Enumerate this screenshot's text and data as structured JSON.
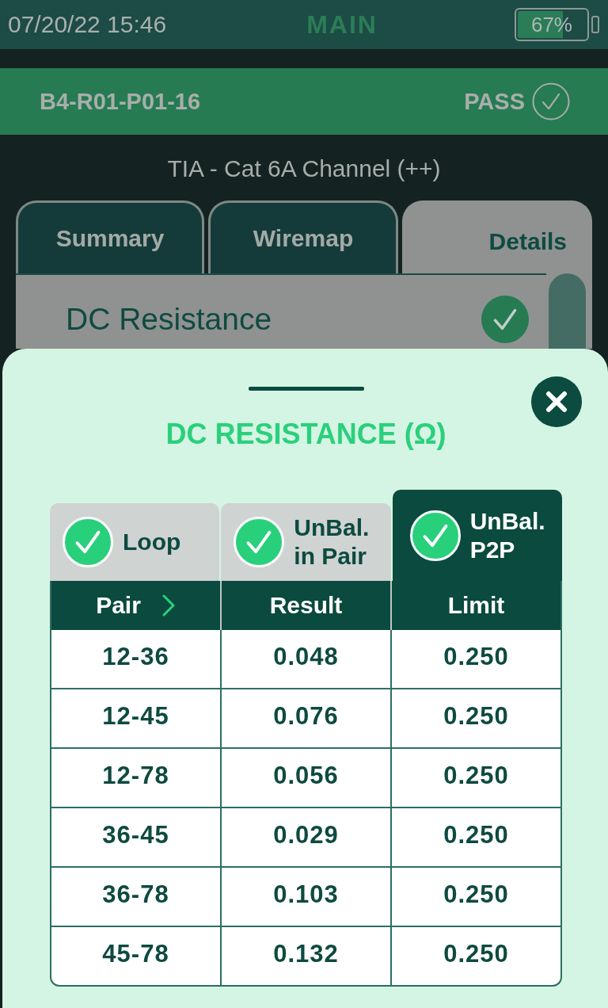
{
  "status_bar": {
    "datetime": "07/20/22 15:46",
    "mode": "MAIN",
    "battery": "67%"
  },
  "record": {
    "id": "B4-R01-P01-16",
    "result": "PASS",
    "passed": true
  },
  "standard": "TIA - Cat 6A Channel (++)",
  "tabs": [
    {
      "label": "Summary",
      "selected": false
    },
    {
      "label": "Wiremap",
      "selected": false
    },
    {
      "label": "Details",
      "selected": true
    }
  ],
  "test_list": [
    {
      "label": "DC Resistance",
      "passed": true
    }
  ],
  "sheet": {
    "title": "DC RESISTANCE (Ω)",
    "subtabs": [
      {
        "label": "Loop",
        "passed": true,
        "selected": false
      },
      {
        "label": "UnBal. in Pair",
        "passed": true,
        "selected": false
      },
      {
        "label": "UnBal. P2P",
        "passed": true,
        "selected": true
      }
    ],
    "table": {
      "columns": [
        "Pair",
        "Result",
        "Limit"
      ],
      "rows": [
        [
          "12-36",
          "0.048",
          "0.250"
        ],
        [
          "12-45",
          "0.076",
          "0.250"
        ],
        [
          "12-78",
          "0.056",
          "0.250"
        ],
        [
          "36-45",
          "0.029",
          "0.250"
        ],
        [
          "36-78",
          "0.103",
          "0.250"
        ],
        [
          "45-78",
          "0.132",
          "0.250"
        ]
      ]
    }
  }
}
